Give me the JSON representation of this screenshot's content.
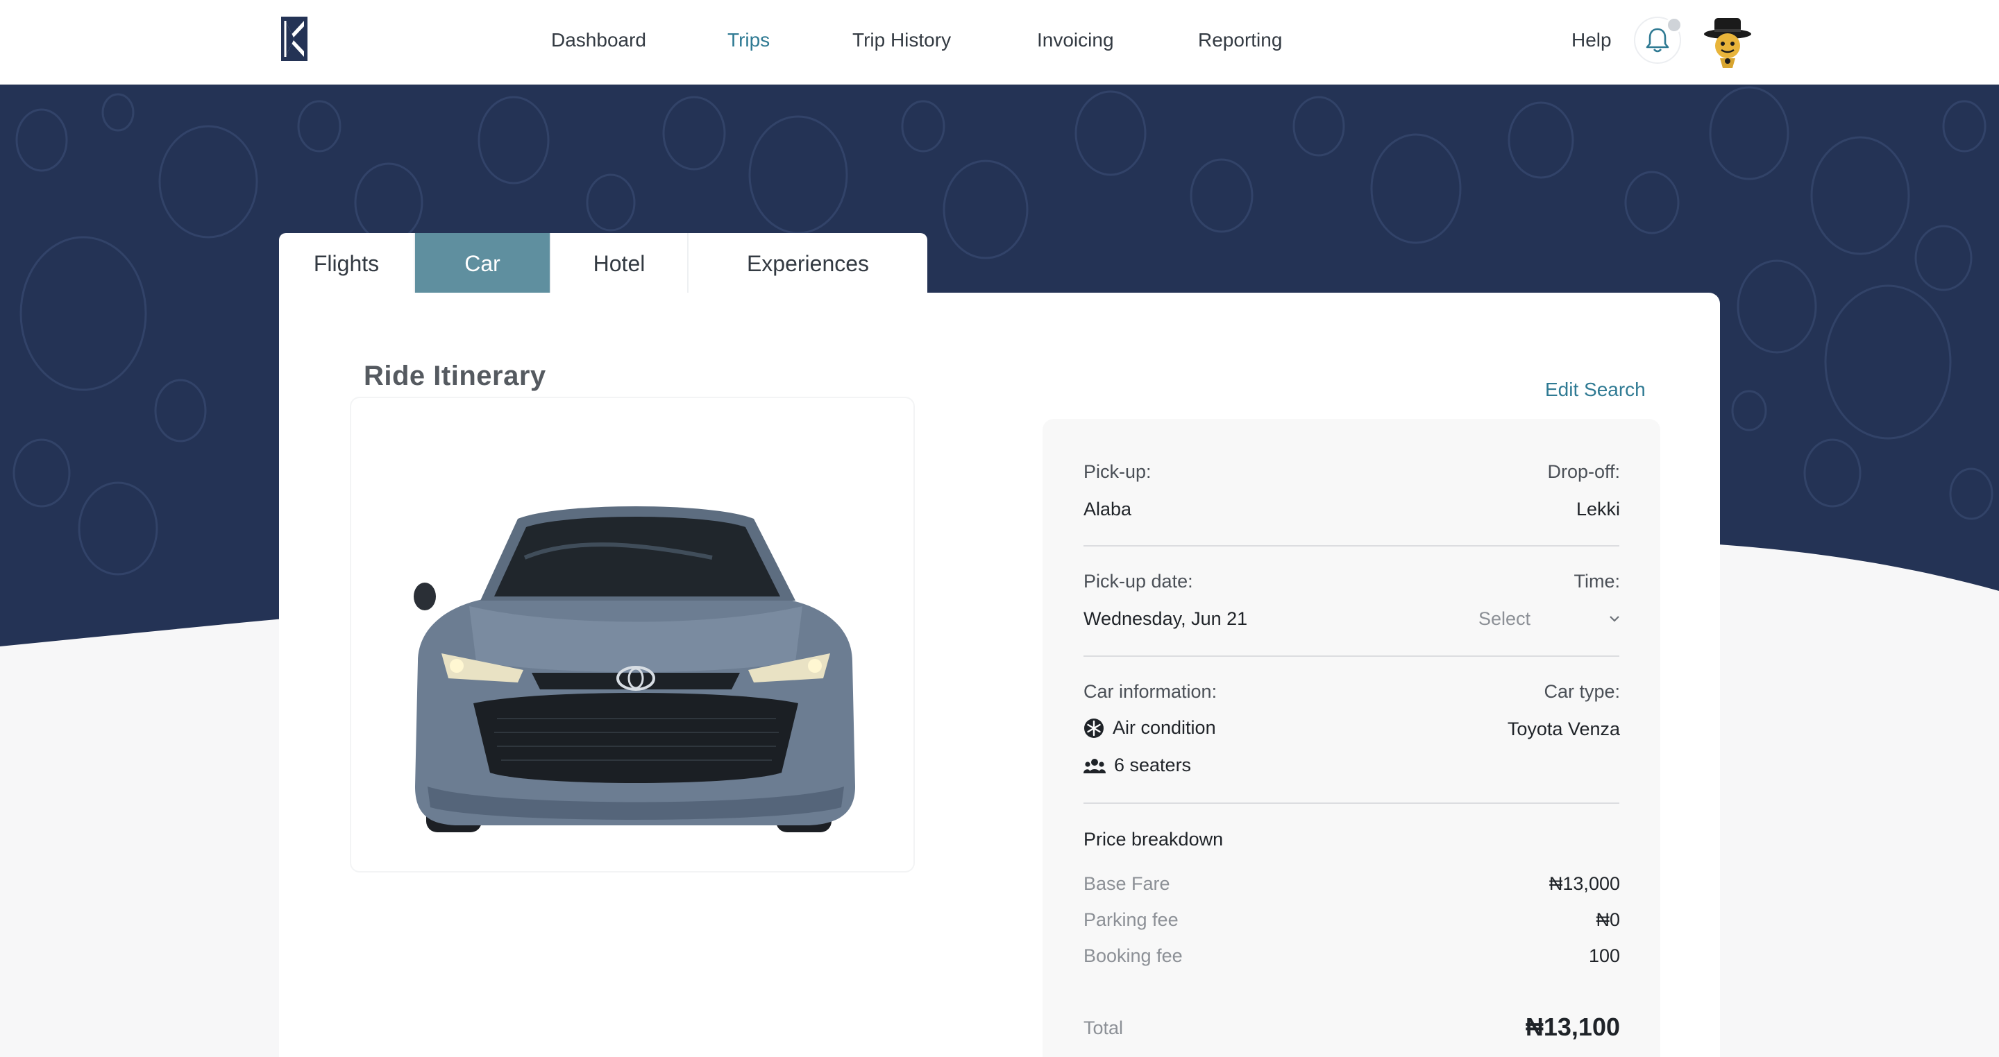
{
  "nav": {
    "items": [
      "Dashboard",
      "Trips",
      "Trip History",
      "Invoicing",
      "Reporting"
    ],
    "active": "Trips",
    "help": "Help"
  },
  "tabs": [
    "Flights",
    "Car",
    "Hotel",
    "Experiences"
  ],
  "active_tab": "Car",
  "main": {
    "title": "Ride Itinerary",
    "edit_search": "Edit Search"
  },
  "itinerary": {
    "pickup_label": "Pick-up:",
    "pickup_value": "Alaba",
    "dropoff_label": "Drop-off:",
    "dropoff_value": "Lekki",
    "date_label": "Pick-up date:",
    "date_value": "Wednesday, Jun 21",
    "time_label": "Time:",
    "time_placeholder": "Select",
    "car_info_label": "Car information:",
    "car_type_label": "Car type:",
    "car_type_value": "Toyota Venza",
    "features": [
      "Air condition",
      "6 seaters"
    ]
  },
  "price": {
    "heading": "Price breakdown",
    "rows": [
      {
        "label": "Base Fare",
        "value": "₦13,000"
      },
      {
        "label": "Parking fee",
        "value": "₦0"
      },
      {
        "label": "Booking fee",
        "value": "100"
      }
    ],
    "total_label": "Total",
    "total_value": "₦13,100"
  },
  "colors": {
    "brand_navy": "#243355",
    "accent": "#2f7a93",
    "active_tab": "#5f8f9f"
  },
  "icons": [
    "brand-logo-icon",
    "bell-icon",
    "avatar",
    "snowflake-icon",
    "people-icon",
    "chevron-down-icon"
  ]
}
